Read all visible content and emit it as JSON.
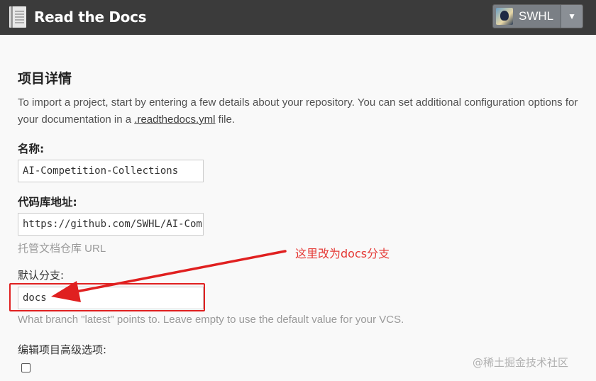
{
  "navbar": {
    "brand": "Read the Docs",
    "user": "SWHL",
    "caret": "▼"
  },
  "page": {
    "title": "项目详情",
    "intro_before": "To import a project, start by entering a few details about your repository. You can set additional configuration options for your documentation in a ",
    "intro_link": ".readthedocs.yml",
    "intro_after": " file."
  },
  "fields": {
    "name_label": "名称:",
    "name_value": "AI-Competition-Collections",
    "repo_label": "代码库地址:",
    "repo_value": "https://github.com/SWHL/AI-Competition-Collections",
    "repo_help": "托管文档仓库 URL",
    "branch_label": "默认分支:",
    "branch_value": "docs",
    "branch_help": "What branch \"latest\" points to. Leave empty to use the default value for your VCS.",
    "advanced_label": "编辑项目高级选项:"
  },
  "annotation": {
    "text": "这里改为docs分支",
    "color": "#e53935"
  },
  "watermark": "@稀土掘金技术社区"
}
